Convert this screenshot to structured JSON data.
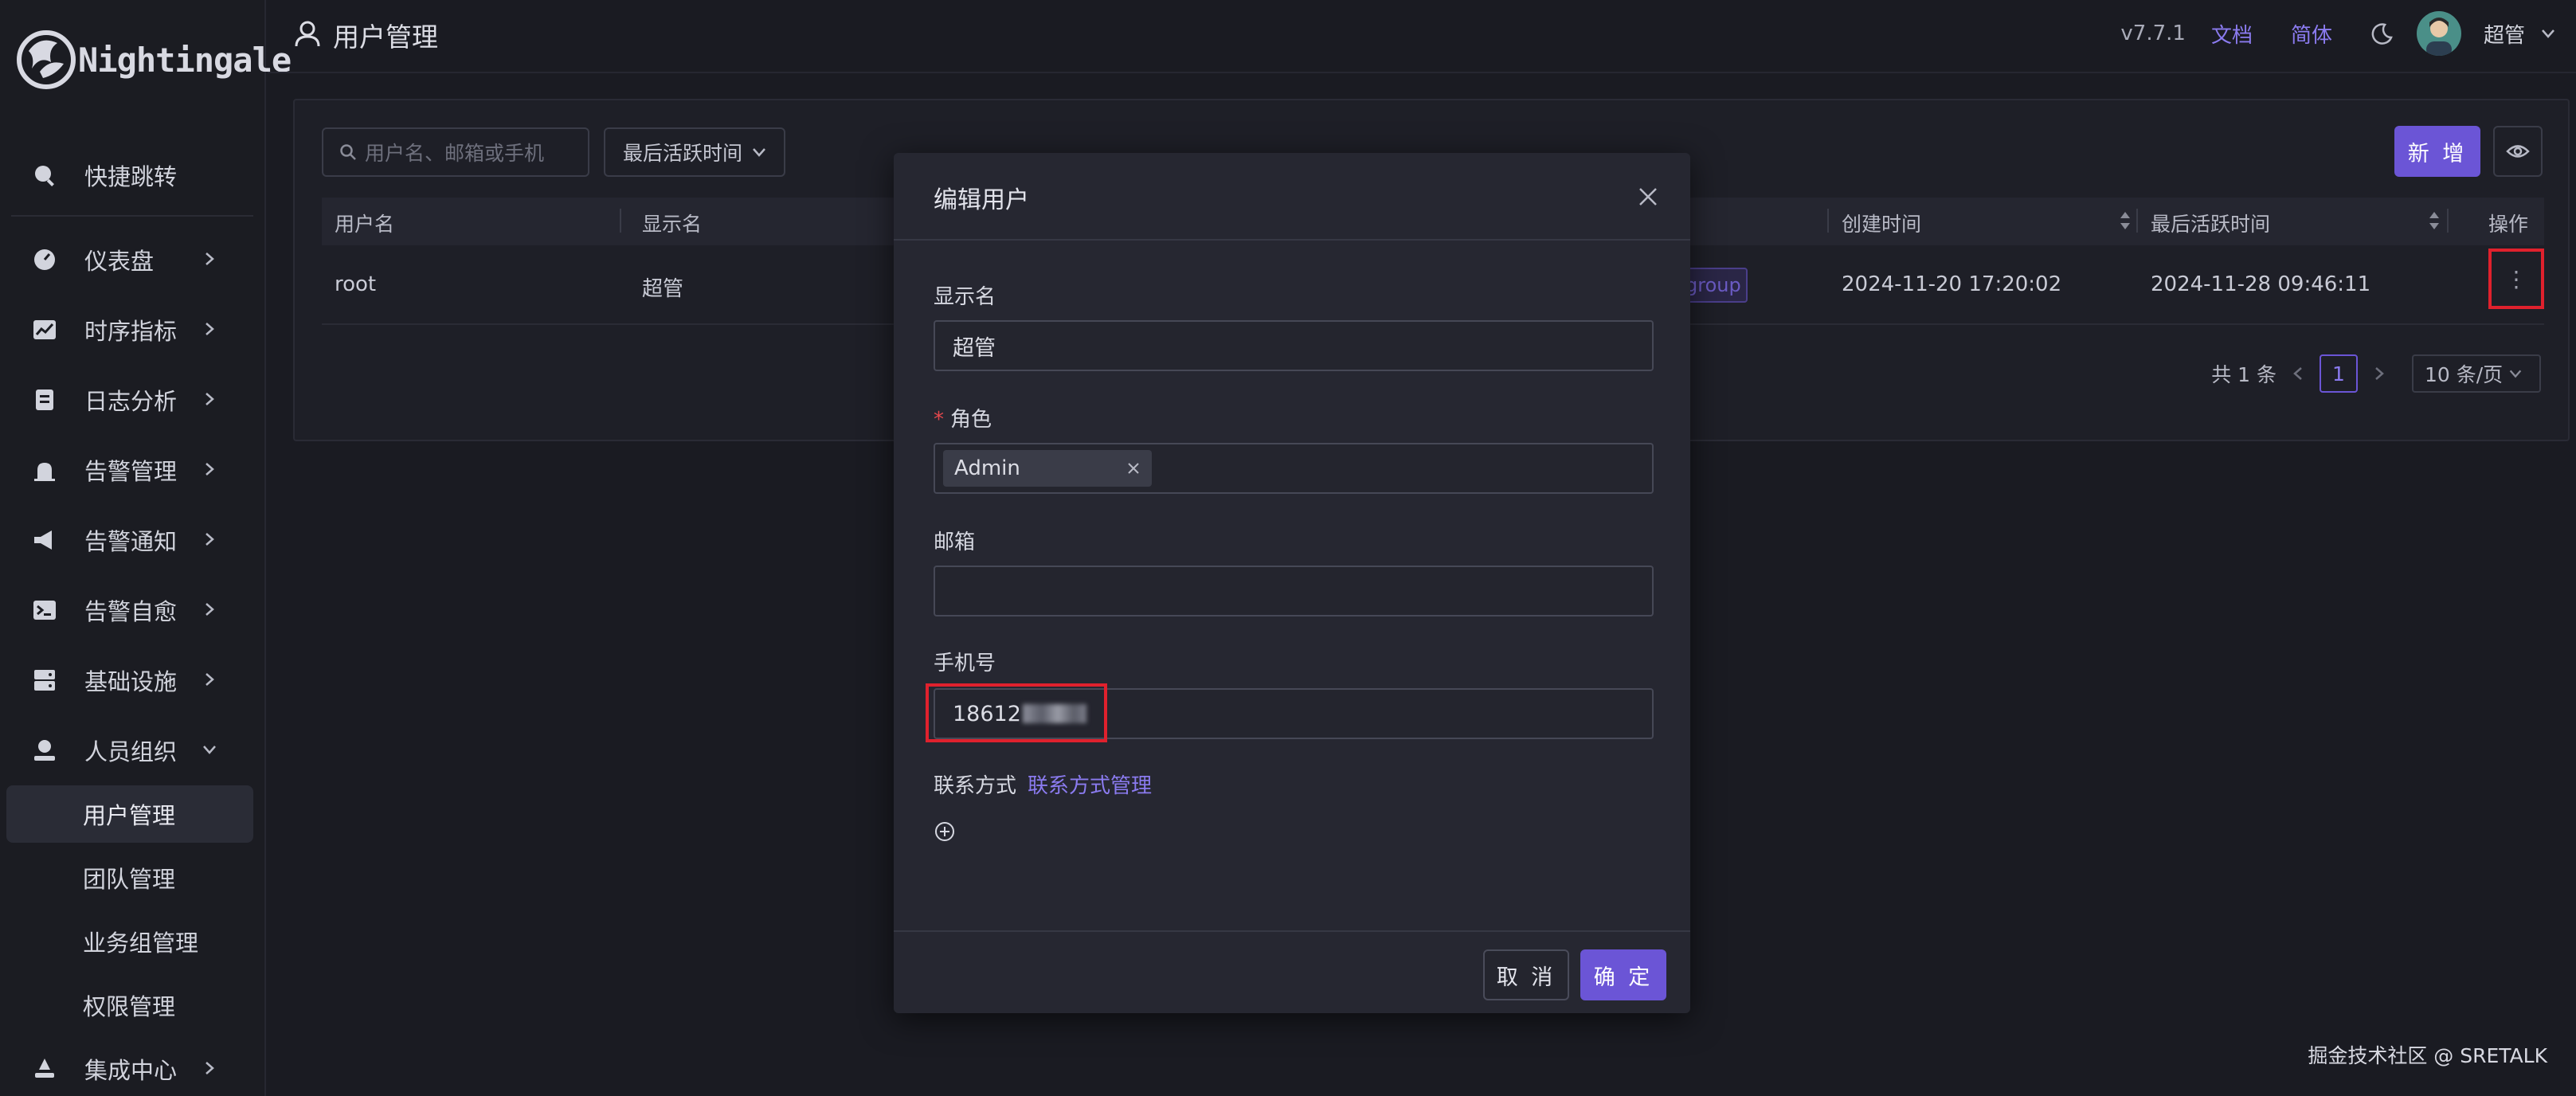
{
  "app": {
    "logo_text": "Nightingale"
  },
  "sidebar": {
    "items": [
      {
        "label": "快捷跳转",
        "icon": "search-icon"
      },
      {
        "label": "仪表盘",
        "icon": "dashboard-icon"
      },
      {
        "label": "时序指标",
        "icon": "chart-icon"
      },
      {
        "label": "日志分析",
        "icon": "log-icon"
      },
      {
        "label": "告警管理",
        "icon": "alarm-icon"
      },
      {
        "label": "告警通知",
        "icon": "megaphone-icon"
      },
      {
        "label": "告警自愈",
        "icon": "terminal-icon"
      },
      {
        "label": "基础设施",
        "icon": "server-icon"
      },
      {
        "label": "人员组织",
        "icon": "user-icon"
      },
      {
        "label": "用户管理",
        "icon": ""
      },
      {
        "label": "团队管理",
        "icon": ""
      },
      {
        "label": "业务组管理",
        "icon": ""
      },
      {
        "label": "权限管理",
        "icon": ""
      },
      {
        "label": "集成中心",
        "icon": "integration-icon"
      }
    ]
  },
  "header": {
    "title": "用户管理",
    "version": "v7.7.1",
    "docs": "文档",
    "lang": "简体",
    "username": "超管"
  },
  "toolbar": {
    "search_placeholder": "用户名、邮箱或手机",
    "sort_label": "最后活跃时间",
    "add_label": "新 增"
  },
  "table": {
    "headers": [
      "用户名",
      "显示名",
      "创建时间",
      "最后活跃时间",
      "操作"
    ],
    "rows": [
      {
        "username": "root",
        "nickname": "超管",
        "tag": "group",
        "created": "2024-11-20 17:20:02",
        "last_active": "2024-11-28 09:46:11",
        "action": "⋮"
      }
    ]
  },
  "pagination": {
    "total": "共 1 条",
    "current": "1",
    "per_page": "10 条/页"
  },
  "modal": {
    "title": "编辑用户",
    "display_name_label": "显示名",
    "display_name_value": "超管",
    "role_label": "角色",
    "role_value": "Admin",
    "email_label": "邮箱",
    "email_value": "",
    "phone_label": "手机号",
    "phone_value": "18612",
    "contact_label": "联系方式",
    "contact_link": "联系方式管理",
    "cancel_label": "取 消",
    "ok_label": "确 定"
  },
  "watermark": "掘金技术社区 @ SRETALK",
  "colors": {
    "accent": "#6b55d6",
    "link": "#8b7bf0",
    "highlight": "#e0212d"
  }
}
